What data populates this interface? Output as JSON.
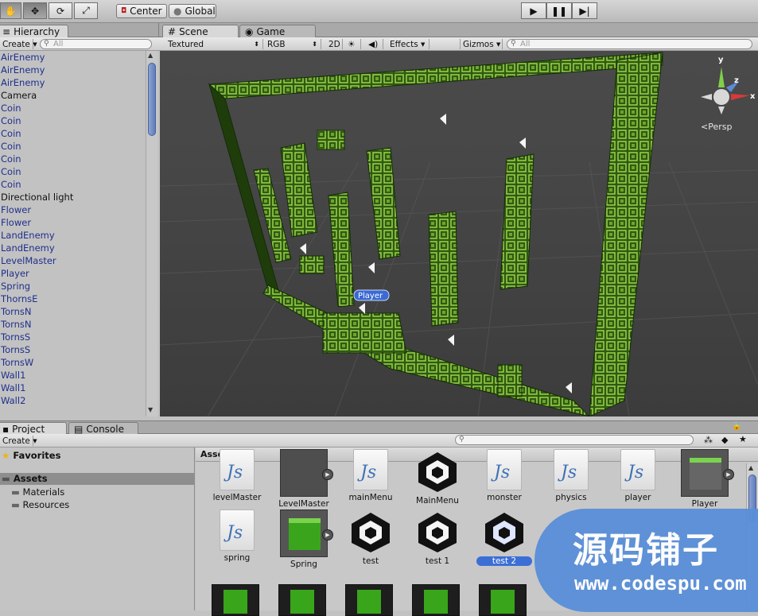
{
  "toolbar": {
    "tools": [
      "hand-icon",
      "move-icon",
      "rotate-icon",
      "scale-icon"
    ],
    "pivot_label": "Center",
    "space_label": "Global",
    "play_controls": [
      "play-icon",
      "pause-icon",
      "step-icon"
    ]
  },
  "hierarchy": {
    "tab_label": "Hierarchy",
    "create_label": "Create",
    "search_placeholder": "All",
    "items": [
      {
        "label": "AirEnemy"
      },
      {
        "label": "AirEnemy"
      },
      {
        "label": "AirEnemy"
      },
      {
        "label": "Camera"
      },
      {
        "label": "Coin"
      },
      {
        "label": "Coin"
      },
      {
        "label": "Coin"
      },
      {
        "label": "Coin"
      },
      {
        "label": "Coin"
      },
      {
        "label": "Coin"
      },
      {
        "label": "Coin"
      },
      {
        "label": "Directional light"
      },
      {
        "label": "Flower"
      },
      {
        "label": "Flower"
      },
      {
        "label": "LandEnemy"
      },
      {
        "label": "LandEnemy"
      },
      {
        "label": "LevelMaster"
      },
      {
        "label": "Player"
      },
      {
        "label": "Spring"
      },
      {
        "label": "ThornsE"
      },
      {
        "label": "TornsN"
      },
      {
        "label": "TornsN"
      },
      {
        "label": "TornsS"
      },
      {
        "label": "TornsS"
      },
      {
        "label": "TornsW"
      },
      {
        "label": "Wall1"
      },
      {
        "label": "Wall1"
      },
      {
        "label": "Wall2"
      }
    ],
    "black_items": [
      3,
      11
    ]
  },
  "scene": {
    "tabs": [
      "Scene",
      "Game"
    ],
    "shading": "Textured",
    "render": "RGB",
    "mode_2d": "2D",
    "effects_label": "Effects",
    "gizmos_label": "Gizmos",
    "search_placeholder": "All",
    "gizmo_axes": {
      "y": "y",
      "z": "z",
      "x": "x"
    },
    "projection": "Persp",
    "player_tag": "Player"
  },
  "bottom_tabs": [
    "Project",
    "Console"
  ],
  "project": {
    "create_label": "Create",
    "favorites_label": "Favorites",
    "assets_label": "Assets",
    "folders": [
      "Materials",
      "Resources"
    ],
    "breadcrumb": "Assets",
    "assets_row1": [
      {
        "label": "levelMaster",
        "type": "js"
      },
      {
        "label": "LevelMaster",
        "type": "prefab-dark"
      },
      {
        "label": "mainMenu",
        "type": "js"
      },
      {
        "label": "MainMenu",
        "type": "unity"
      },
      {
        "label": "monster",
        "type": "js"
      },
      {
        "label": "physics",
        "type": "js"
      },
      {
        "label": "player",
        "type": "js"
      },
      {
        "label": "Player",
        "type": "prefab-cube"
      }
    ],
    "assets_row2": [
      {
        "label": "spring",
        "type": "js"
      },
      {
        "label": "Spring",
        "type": "cube"
      },
      {
        "label": "test",
        "type": "unity"
      },
      {
        "label": "test 1",
        "type": "unity"
      },
      {
        "label": "test 2",
        "type": "unity",
        "selected": true
      }
    ]
  },
  "watermark": {
    "title": "源码铺子",
    "url": "www.codespu.com"
  }
}
